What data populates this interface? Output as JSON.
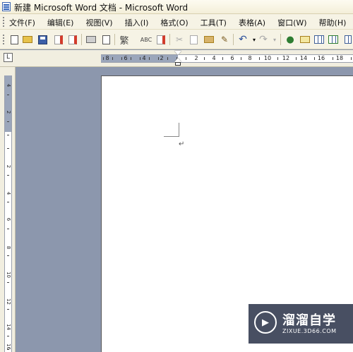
{
  "window": {
    "title": "新建 Microsoft Word 文档 - Microsoft Word"
  },
  "menu": {
    "items": [
      "文件(F)",
      "编辑(E)",
      "视图(V)",
      "插入(I)",
      "格式(O)",
      "工具(T)",
      "表格(A)",
      "窗口(W)",
      "帮助(H)"
    ]
  },
  "toolbar": {
    "buttons": [
      "new-icon",
      "open-icon",
      "save-icon",
      "permission-icon",
      "print-preview-icon",
      "print-icon",
      "research-icon",
      "spell-check-icon",
      "cut-icon",
      "copy-icon",
      "paste-icon",
      "format-painter-icon",
      "undo-icon",
      "redo-icon",
      "hyperlink-icon",
      "tables-borders-icon",
      "insert-table-icon",
      "insert-excel-icon",
      "columns-icon"
    ],
    "glyphs": {
      "style": "繁",
      "spell": "ABC"
    }
  },
  "ruler": {
    "corner_label": "L",
    "h_numbers": [
      "8",
      "6",
      "4",
      "2",
      "2",
      "4",
      "6",
      "8",
      "10",
      "12",
      "14",
      "16",
      "18"
    ],
    "v_numbers": [
      "4",
      "2",
      "2",
      "4",
      "6",
      "8",
      "10",
      "12",
      "14",
      "16"
    ]
  },
  "document": {
    "paragraph_mark": "↵"
  },
  "watermark": {
    "name": "溜溜自学",
    "url": "ZIXUE.3D66.COM",
    "logo_symbol": "▶"
  },
  "colors": {
    "workspace": "#8c97ad",
    "title_bar": "#f4efd9",
    "page": "#ffffff"
  }
}
